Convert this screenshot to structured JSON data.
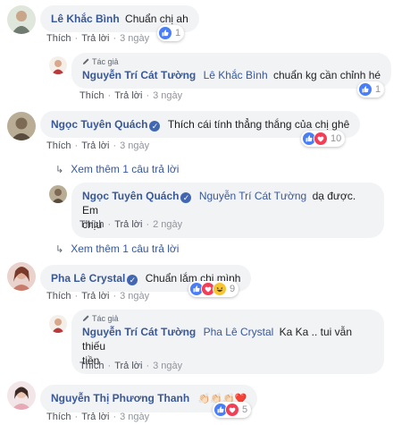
{
  "actions": {
    "like": "Thích",
    "reply": "Trả lời",
    "sep": "·"
  },
  "author_badge": "Tác giả",
  "comments": [
    {
      "author": "Lê Khắc Bình",
      "text": "Chuẩn chị ah",
      "time": "3 ngày",
      "count": "1"
    },
    {
      "author": "Nguyễn Trí Cát Tường",
      "tag": "Lê Khắc Bình",
      "text": "chuẩn kg cần chỉnh hé",
      "time": "3 ngày",
      "count": "1"
    },
    {
      "author": "Ngọc Tuyên Quách",
      "text": "Thích cái tính thẳng thắng của chị ghê",
      "time": "3 ngày",
      "count": "10"
    },
    {
      "author": "Ngọc Tuyên Quách",
      "tag": "Nguyễn Trí Cát Tường",
      "text": "dạ được. Em",
      "text2": "chịu",
      "time": "2 ngày"
    },
    {
      "author": "Pha Lê Crystal",
      "text": "Chuẩn lắm chị mình",
      "time": "3 ngày",
      "count": "9"
    },
    {
      "author": "Nguyễn Trí Cát Tường",
      "tag": "Pha Lê Crystal",
      "text": "Ka Ka .. tui vẫn thiếu",
      "text2": "tiền",
      "time": "3 ngày"
    },
    {
      "author": "Nguyễn Thị Phương Thanh",
      "text": "👏🏻👏🏻👏🏻❤️",
      "time": "3 ngày",
      "count": "5"
    }
  ],
  "view_more": [
    "Xem thêm 1 câu trả lời",
    "Xem thêm 1 câu trả lời"
  ],
  "colors": {
    "link": "#385898",
    "bubble": "#f2f3f5",
    "like": "#4267b2",
    "love": "#f33e58",
    "haha": "#f7b125"
  }
}
